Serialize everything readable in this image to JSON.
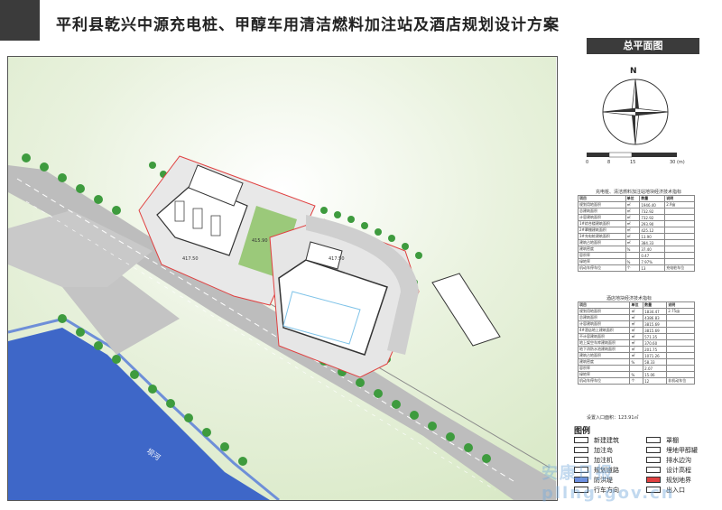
{
  "title": "平利县乾兴中源充电桩、甲醇车用清洁燃料加注站及酒店规划设计方案",
  "sheet_label": "总平面图",
  "compass": {
    "north": "N"
  },
  "scale_bar": {
    "ticks": [
      "0",
      "8",
      "15",
      "30 (m)"
    ]
  },
  "table1": {
    "caption": "充电桩、清洁燃料加注站地块经济技术指标",
    "header": [
      "项目",
      "单位",
      "数量",
      "说明"
    ],
    "rows": [
      [
        "规划用地面积",
        "㎡",
        "1946.40",
        "2.9亩"
      ],
      [
        "总建筑面积",
        "㎡",
        "732.92",
        ""
      ],
      [
        "计容建筑面积",
        "㎡",
        "732.92",
        ""
      ],
      [
        "1#综合楼建筑面积",
        "㎡",
        "293.90",
        ""
      ],
      [
        "2#罩棚建筑面积",
        "㎡",
        "425.12",
        ""
      ],
      [
        "3#充电桩建筑面积",
        "㎡",
        "13.90",
        ""
      ],
      [
        "建筑占地面积",
        "㎡",
        "384.33",
        ""
      ],
      [
        "建筑密度",
        "%",
        "37.40",
        ""
      ],
      [
        "容积率",
        "",
        "0.47",
        ""
      ],
      [
        "绿地率",
        "%",
        "7.97%",
        ""
      ],
      [
        "机动车停车位",
        "个",
        "13",
        "充电桩车位"
      ]
    ]
  },
  "table2": {
    "caption": "酒店地块经济技术指标",
    "header": [
      "项目",
      "单位",
      "数量",
      "说明"
    ],
    "rows": [
      [
        "规划用地面积",
        "㎡",
        "1834.47",
        "2.75亩"
      ],
      [
        "总建筑面积",
        "㎡",
        "4386.83",
        ""
      ],
      [
        "计容建筑面积",
        "㎡",
        "3815.69",
        ""
      ],
      [
        "4#酒店地上建筑面积",
        "㎡",
        "3815.69",
        ""
      ],
      [
        "不计容建筑面积",
        "㎡",
        "571.35",
        ""
      ],
      [
        "地上架空车库建筑面积",
        "㎡",
        "370.60",
        ""
      ],
      [
        "地下消防水池建筑面积",
        "㎡",
        "201.75",
        ""
      ],
      [
        "建筑占地面积",
        "㎡",
        "1071.26",
        ""
      ],
      [
        "建筑密度",
        "%",
        "58.33",
        ""
      ],
      [
        "容积率",
        "",
        "2.07",
        ""
      ],
      [
        "绿地率",
        "%",
        "15.06",
        ""
      ],
      [
        "机动车停车位",
        "个",
        "12",
        "非机动车位"
      ]
    ],
    "note": "设置入口面积：123.91㎡"
  },
  "legend": {
    "title": "图例",
    "items": [
      {
        "label": "新建建筑",
        "color": "#ffffff"
      },
      {
        "label": "罩棚",
        "color": "#ffffff"
      },
      {
        "label": "加注岛",
        "color": "#ffffff"
      },
      {
        "label": "埋地甲醇罐",
        "color": "#ffffff"
      },
      {
        "label": "加注机",
        "color": "#ffffff"
      },
      {
        "label": "排水边沟",
        "color": "#ffffff"
      },
      {
        "label": "规划道路",
        "color": "#ffffff"
      },
      {
        "label": "设计高程",
        "color": "#ffffff"
      },
      {
        "label": "防洪堤",
        "color": "#6d8fe0"
      },
      {
        "label": "规划地界",
        "color": "#e04040"
      },
      {
        "label": "行车方向",
        "color": "#ffffff"
      },
      {
        "label": "出入口",
        "color": "#ffffff"
      }
    ]
  },
  "map_labels": {
    "river": "坝河",
    "elev1": "417.50",
    "elev2": "415.90",
    "elev3": "417.50"
  },
  "watermark": "安康日报 pllng.gov.cn"
}
